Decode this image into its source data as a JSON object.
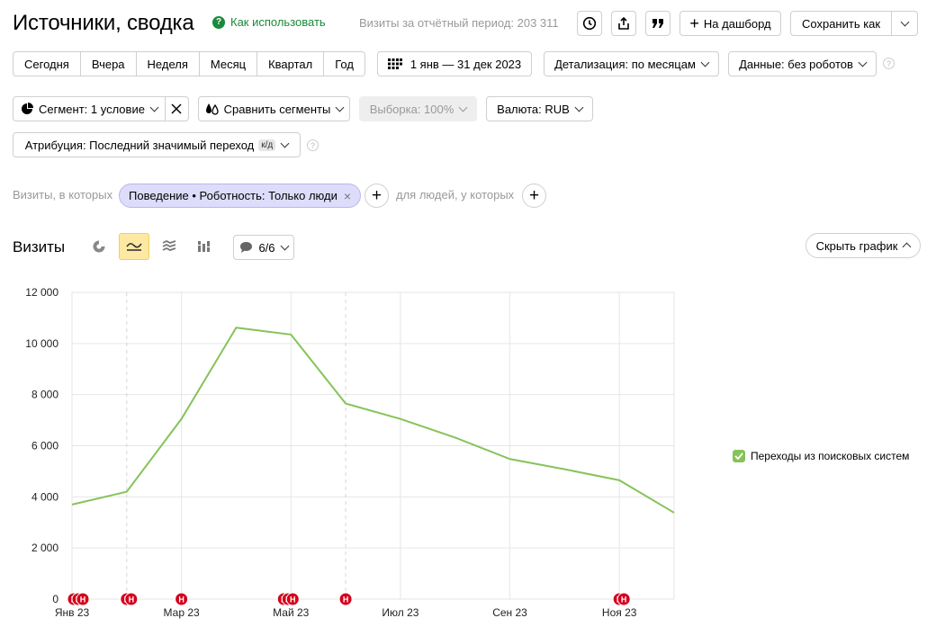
{
  "header": {
    "title": "Источники, сводка",
    "how_to_use": "Как использовать",
    "visits_total": "Визиты за отчётный период: 203 311"
  },
  "toolbar": {
    "history_icon": "clock-icon",
    "export_icon": "share-icon",
    "quote_icon": "quote-icon",
    "dashboard_label": "На дашборд",
    "save_as_label": "Сохранить как"
  },
  "period": {
    "options": [
      "Сегодня",
      "Вчера",
      "Неделя",
      "Месяц",
      "Квартал",
      "Год"
    ],
    "date_range": "1 янв — 31 дек 2023",
    "detail": "Детализация: по месяцам",
    "data": "Данные: без роботов"
  },
  "segments": {
    "segment": "Сегмент: 1 условие",
    "compare": "Сравнить сегменты",
    "sample": "Выборка: 100%",
    "currency": "Валюта: RUB",
    "attribution": "Атрибуция: Последний значимый переход",
    "attribution_badge": "к/д"
  },
  "filter": {
    "prefix": "Визиты, в которых",
    "chip": "Поведение • Роботность: Только люди",
    "people": "для людей, у которых"
  },
  "chart_section": {
    "title": "Визиты",
    "annotations_count": "6/6",
    "hide_chart": "Скрыть график"
  },
  "chart_data": {
    "type": "line",
    "x": [
      "Янв 23",
      "Фев 23",
      "Мар 23",
      "Апр 23",
      "Май 23",
      "Июн 23",
      "Июл 23",
      "Авг 23",
      "Сен 23",
      "Окт 23",
      "Ноя 23",
      "Дек 23"
    ],
    "x_tick_labels": [
      "Янв 23",
      "Мар 23",
      "Май 23",
      "Июл 23",
      "Сен 23",
      "Ноя 23"
    ],
    "series": [
      {
        "name": "Переходы из поисковых систем",
        "color": "#86c35a",
        "values": [
          3700,
          4200,
          7050,
          10620,
          10350,
          7650,
          7050,
          6320,
          5480,
          5080,
          4650,
          3380
        ]
      }
    ],
    "ylim": [
      0,
      12000
    ],
    "y_ticks": [
      "0",
      "2 000",
      "4 000",
      "6 000",
      "8 000",
      "10 000",
      "12 000"
    ],
    "grid": true,
    "legend_position": "right"
  },
  "markers": {
    "label": "Н",
    "color": "#d4001a"
  }
}
